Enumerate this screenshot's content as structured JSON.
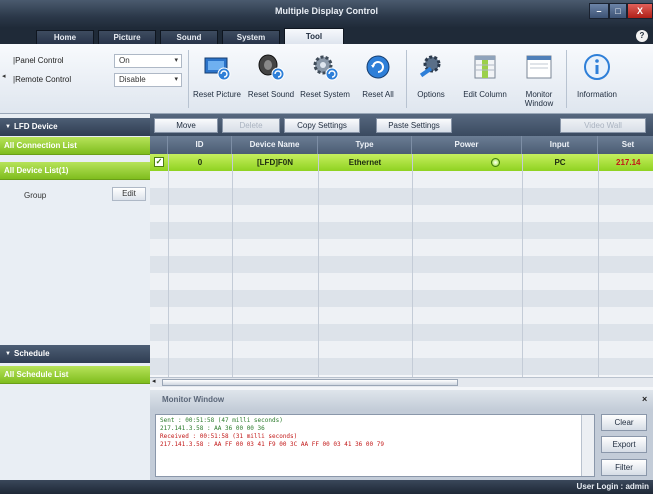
{
  "window": {
    "title": "Multiple Display Control",
    "controls": [
      "–",
      "□",
      "X"
    ]
  },
  "tabs": [
    {
      "label": "Home"
    },
    {
      "label": "Picture"
    },
    {
      "label": "Sound"
    },
    {
      "label": "System"
    },
    {
      "label": "Tool",
      "active": true
    }
  ],
  "help_glyph": "?",
  "ribbon": {
    "panel_control_label": "Panel Control",
    "panel_control_value": "On",
    "remote_control_label": "Remote Control",
    "remote_control_value": "Disable",
    "left_arrow": "◂",
    "buttons": [
      {
        "label": "Reset Picture",
        "icon": "reset-picture-icon"
      },
      {
        "label": "Reset Sound",
        "icon": "reset-sound-icon"
      },
      {
        "label": "Reset System",
        "icon": "reset-system-icon"
      },
      {
        "label": "Reset All",
        "icon": "reset-all-icon"
      },
      {
        "label": "Options",
        "icon": "options-icon"
      },
      {
        "label": "Edit Column",
        "icon": "edit-column-icon"
      },
      {
        "label": "Monitor Window",
        "icon": "monitor-window-icon"
      },
      {
        "label": "Information",
        "icon": "information-icon"
      }
    ]
  },
  "sidebar": {
    "lfd_header": "LFD Device",
    "all_connection_list": "All Connection List",
    "all_device_list": "All Device List(1)",
    "group_label": "Group",
    "edit_label": "Edit",
    "schedule_header": "Schedule",
    "all_schedule_list": "All Schedule List"
  },
  "toolbar": {
    "move": "Move",
    "delete": "Delete",
    "copy_settings": "Copy Settings",
    "paste_settings": "Paste Settings",
    "video_wall": "Video Wall"
  },
  "grid": {
    "columns": [
      "ID",
      "Device Name",
      "Type",
      "Power",
      "Input",
      "Set"
    ],
    "rows": [
      {
        "checked": true,
        "id": "0",
        "device_name": "[LFD]F0N",
        "type": "Ethernet",
        "power": "on",
        "input": "PC",
        "set": "217.14"
      }
    ],
    "empty_rows": 12
  },
  "monitor": {
    "title": "Monitor Window",
    "log": [
      {
        "kind": "sent",
        "text": "Sent : 00:51:58 (47 milli seconds)"
      },
      {
        "kind": "sent",
        "text": " 217.141.3.58 : AA 36 00 00 36"
      },
      {
        "kind": "blank",
        "text": " "
      },
      {
        "kind": "recv",
        "text": "Received : 00:51:58 (31 milli seconds)"
      },
      {
        "kind": "recv",
        "text": " 217.141.3.58 : AA FF 00 03 41 F9 00 3C AA FF 00 03 41 36 00 79"
      }
    ],
    "clear": "Clear",
    "export": "Export",
    "filter": "Filter"
  },
  "status": {
    "user_login": "User Login : admin"
  },
  "colors": {
    "accent_green": "#8fd221",
    "header_dark": "#2f3d52",
    "log_sent": "#2a7a2a",
    "log_recv": "#c21818"
  }
}
